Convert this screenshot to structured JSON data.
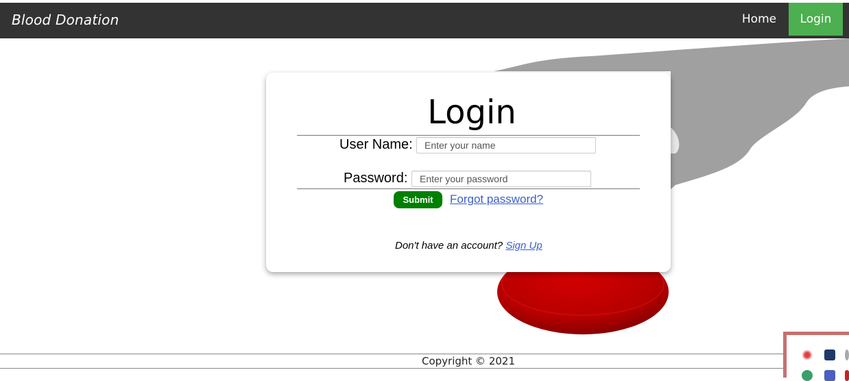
{
  "navbar": {
    "brand": "Blood Donation",
    "links": [
      {
        "label": "Home",
        "active": false
      },
      {
        "label": "Login",
        "active": true
      }
    ],
    "background_color": "#333333",
    "active_color": "#4caf50"
  },
  "login_card": {
    "title": "Login",
    "username_label": "User Name:",
    "username_placeholder": "Enter your name",
    "username_value": "",
    "password_label": "Password:",
    "password_placeholder": "Enter your password",
    "password_value": "",
    "submit_label": "Submit",
    "submit_color": "#008000",
    "forgot_label": "Forgot password?",
    "signup_prompt": "Don't have an account?",
    "signup_label": "Sign Up",
    "link_color": "#3b5fcc"
  },
  "footer": {
    "copyright": "Copyright © 2021"
  },
  "background": {
    "illustration": "hand-with-blood-drop",
    "drop_color": "#c00000",
    "hand_color": "#a0a0a0"
  },
  "system_tray": {
    "icons": [
      "red-bug-icon",
      "dark-square-icon",
      "gray-dot-icon",
      "green-circle-icon",
      "teams-icon",
      "red-alert-icon"
    ]
  }
}
